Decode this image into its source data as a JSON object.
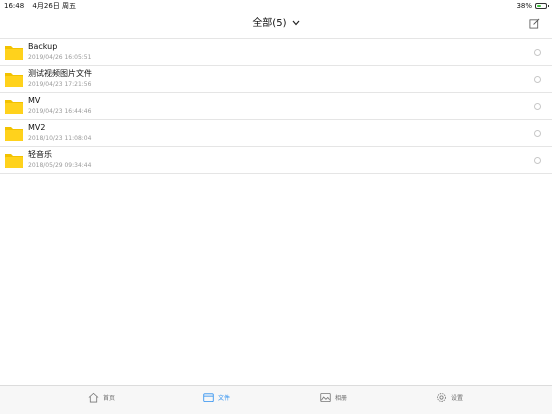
{
  "status_bar": {
    "time": "16:48",
    "date": "4月26日 周五",
    "battery": "38%"
  },
  "nav": {
    "title": "全部(5)"
  },
  "files": [
    {
      "name": "Backup",
      "date": "2019/04/26 16:05:51"
    },
    {
      "name": "测试视频图片文件",
      "date": "2019/04/23 17:21:56"
    },
    {
      "name": "MV",
      "date": "2019/04/23 16:44:46"
    },
    {
      "name": "MV2",
      "date": "2018/10/23 11:08:04"
    },
    {
      "name": "轻音乐",
      "date": "2018/05/29 09:34:44"
    }
  ],
  "tabs": [
    {
      "label": "首页",
      "icon": "home-icon"
    },
    {
      "label": "文件",
      "icon": "folder-tab-icon",
      "active": true
    },
    {
      "label": "相册",
      "icon": "photo-icon"
    },
    {
      "label": "设置",
      "icon": "gear-icon"
    }
  ],
  "colors": {
    "accent": "#2a8ef0",
    "folder": "#ffd21c",
    "battery": "#3cc13b"
  }
}
